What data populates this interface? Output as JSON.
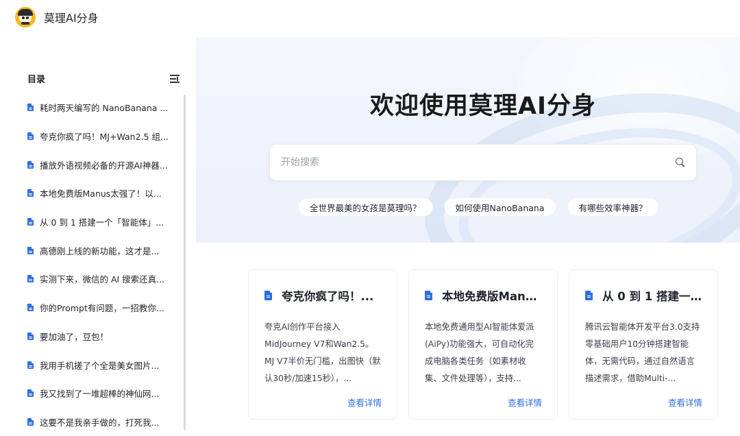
{
  "header": {
    "site_title": "莫理AI分身",
    "logo_icon": "avatar-logo-icon"
  },
  "sidebar": {
    "toc_title": "目录",
    "collapse_icon": "collapse-menu-icon",
    "items": [
      {
        "label": "耗时两天编写的 NanoBanana ..."
      },
      {
        "label": "夸克你疯了吗！MJ+Wan2.5 组..."
      },
      {
        "label": "播放外语视频必备的开源AI神器..."
      },
      {
        "label": "本地免费版Manus太强了！以..."
      },
      {
        "label": "从 0 到 1 搭建一个「智能体」..."
      },
      {
        "label": "高德刚上线的新功能，这才是..."
      },
      {
        "label": "实测下来，微信的 AI 搜索还真..."
      },
      {
        "label": "你的Prompt有问题，一招教你..."
      },
      {
        "label": "要加油了，豆包！"
      },
      {
        "label": "我用手机搓了个全是美女图片..."
      },
      {
        "label": "我又找到了一堆超棒的神仙网..."
      },
      {
        "label": "这要不是我亲手做的，打死我..."
      }
    ]
  },
  "hero": {
    "title": "欢迎使用莫理AI分身",
    "search_placeholder": "开始搜索",
    "chips": [
      {
        "label": "全世界最美的女孩是莫理吗？"
      },
      {
        "label": "如何使用NanoBanana"
      },
      {
        "label": "有哪些效率神器？"
      }
    ]
  },
  "cards": [
    {
      "title": "夸克你疯了吗！...",
      "desc": "夸克AI创作平台接入MidJourney V7和Wan2.5。MJ V7半价无门槛，出图快（默认30秒/加速15秒），...",
      "link": "查看详情"
    },
    {
      "title": "本地免费版Manu...",
      "desc": "本地免费通用型AI智能体爱派(AiPy)功能强大，可自动化完成电脑各类任务（如素材收集、文件处理等），支持...",
      "link": "查看详情"
    },
    {
      "title": "从 0 到 1 搭建一...",
      "desc": "腾讯云智能体开发平台3.0支持零基础用户10分钟搭建智能体，无需代码，通过自然语言描述需求，借助Multi-...",
      "link": "查看详情"
    }
  ],
  "colors": {
    "accent": "#2c6fe6",
    "hero_bg": "#eef2fb",
    "logo_bg": "#f5b820"
  }
}
